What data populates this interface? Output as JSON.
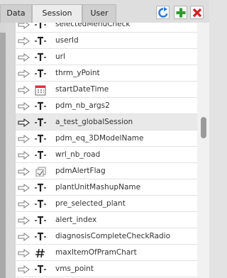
{
  "tabs": [
    {
      "label": "Data",
      "active": false
    },
    {
      "label": "Session",
      "active": true
    },
    {
      "label": "User",
      "active": false
    }
  ],
  "toolbar": {
    "refresh_icon": "refresh-icon",
    "add_icon": "plus-icon",
    "delete_icon": "close-icon",
    "colors": {
      "refresh": "#2a78d8",
      "add": "#2f9b2f",
      "delete": "#d22020"
    }
  },
  "rows": [
    {
      "name": "selectedMenuCheck",
      "type": "text",
      "selected": false
    },
    {
      "name": "userId",
      "type": "text",
      "selected": false
    },
    {
      "name": "url",
      "type": "text",
      "selected": false
    },
    {
      "name": "thrm_yPoint",
      "type": "text",
      "selected": false
    },
    {
      "name": "startDateTime",
      "type": "date",
      "selected": false
    },
    {
      "name": "pdm_nb_args2",
      "type": "text",
      "selected": false
    },
    {
      "name": "a_test_globalSession",
      "type": "text",
      "selected": true
    },
    {
      "name": "pdm_eq_3DModelName",
      "type": "text",
      "selected": false
    },
    {
      "name": "wrl_nb_road",
      "type": "text",
      "selected": false
    },
    {
      "name": "pdmAlertFlag",
      "type": "boolean",
      "selected": false
    },
    {
      "name": "plantUnitMashupName",
      "type": "text",
      "selected": false
    },
    {
      "name": "pre_selected_plant",
      "type": "text",
      "selected": false
    },
    {
      "name": "alert_index",
      "type": "text",
      "selected": false
    },
    {
      "name": "diagnosisCompleteCheckRadio",
      "type": "text",
      "selected": false
    },
    {
      "name": "maxItemOfPramChart",
      "type": "number",
      "selected": false
    },
    {
      "name": "vms_point",
      "type": "text",
      "selected": false
    }
  ]
}
